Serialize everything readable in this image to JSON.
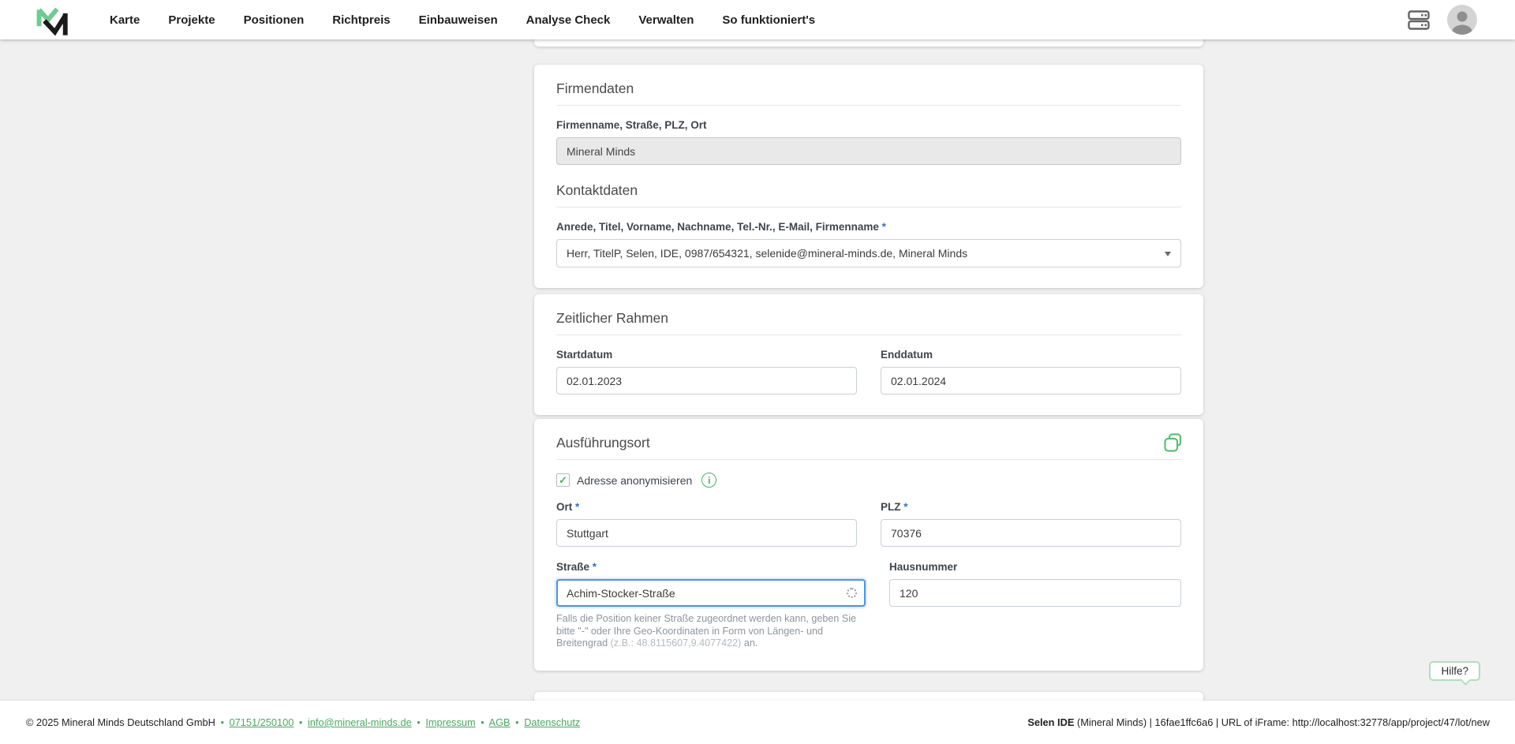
{
  "ui": {
    "required_marker": "*",
    "separator": "•",
    "checkmark": "✓",
    "info_glyph": "i"
  },
  "nav": {
    "items": [
      "Karte",
      "Projekte",
      "Positionen",
      "Richtpreis",
      "Einbauweisen",
      "Analyse Check",
      "Verwalten",
      "So funktioniert's"
    ]
  },
  "firmendaten": {
    "title": "Firmendaten",
    "company_label": "Firmenname, Straße, PLZ, Ort",
    "company_value": "Mineral Minds",
    "contact_title": "Kontaktdaten",
    "contact_label": "Anrede, Titel, Vorname, Nachname, Tel.-Nr., E-Mail, Firmenname",
    "contact_value": "Herr, TitelP, Selen, IDE, 0987/654321, selenide@mineral-minds.de, Mineral Minds"
  },
  "zeitraum": {
    "title": "Zeitlicher Rahmen",
    "start_label": "Startdatum",
    "start_value": "02.01.2023",
    "end_label": "Enddatum",
    "end_value": "02.01.2024"
  },
  "ausfuehrungsort": {
    "title": "Ausführungsort",
    "anonymize_label": "Adresse anonymisieren",
    "city_label": "Ort",
    "city_value": "Stuttgart",
    "zip_label": "PLZ",
    "zip_value": "70376",
    "street_label": "Straße",
    "street_value": "Achim-Stocker-Straße",
    "house_label": "Hausnummer",
    "house_value": "120",
    "hint_part1": "Falls die Position keiner Straße zugeordnet werden kann, geben Sie bitte \"-\" oder Ihre Geo-Koordinaten in Form von Längen- und Breitengrad",
    "hint_example": "(z.B.: 48.8115607,9.4077422)",
    "hint_part2": "an."
  },
  "help": {
    "label": "Hilfe?"
  },
  "footer": {
    "copyright": "© 2025 Mineral Minds Deutschland GmbH",
    "links": [
      "07151/250100",
      "info@mineral-minds.de",
      "Impressum",
      "AGB",
      "Datenschutz"
    ],
    "right_bold": "Selen IDE",
    "right_rest": " (Mineral Minds) | 16fae1ffc6a6 | URL of iFrame: http://localhost:32778/app/project/47/lot/new"
  },
  "colors": {
    "accent_green": "#4cae64",
    "logo_green": "#6fcb92",
    "logo_dark": "#1a1a1a",
    "required_blue": "#3c6eb4",
    "focus_blue": "#4f95da"
  }
}
